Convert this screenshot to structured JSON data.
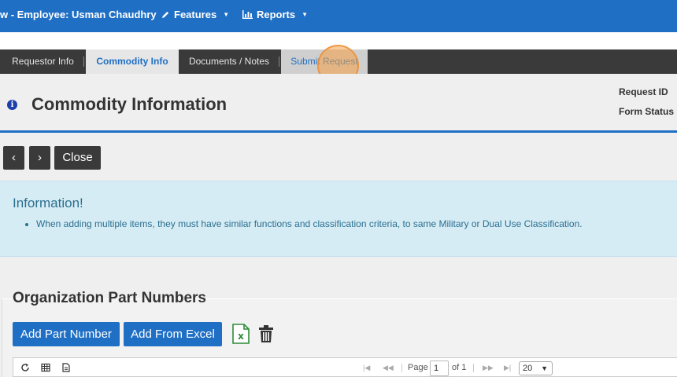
{
  "topbar": {
    "title": "w - Employee: Usman Chaudhry",
    "features_label": "Features",
    "reports_label": "Reports"
  },
  "tabs": [
    {
      "label": "Requestor Info"
    },
    {
      "label": "Commodity Info"
    },
    {
      "label": "Documents / Notes"
    },
    {
      "label": "Submit Request"
    }
  ],
  "header": {
    "title": "Commodity Information",
    "request_id_label": "Request ID",
    "form_status_label": "Form Status"
  },
  "nav_buttons": {
    "prev": "‹",
    "next": "›",
    "close": "Close"
  },
  "alert": {
    "heading": "Information!",
    "items": [
      "When adding multiple items, they must have similar functions and classification criteria, to same Military or Dual Use Classification."
    ]
  },
  "part_numbers": {
    "title": "Organization Part Numbers",
    "add_button": "Add Part Number",
    "add_excel_button": "Add From Excel"
  },
  "pager": {
    "page_label": "Page",
    "page_value": "1",
    "of_label": "of 1",
    "page_size": "20"
  },
  "colors": {
    "primary": "#1f6fc5",
    "tabbar": "#3a3a3a",
    "alert_bg": "#d6ecf4",
    "alert_text": "#2b6f90"
  }
}
